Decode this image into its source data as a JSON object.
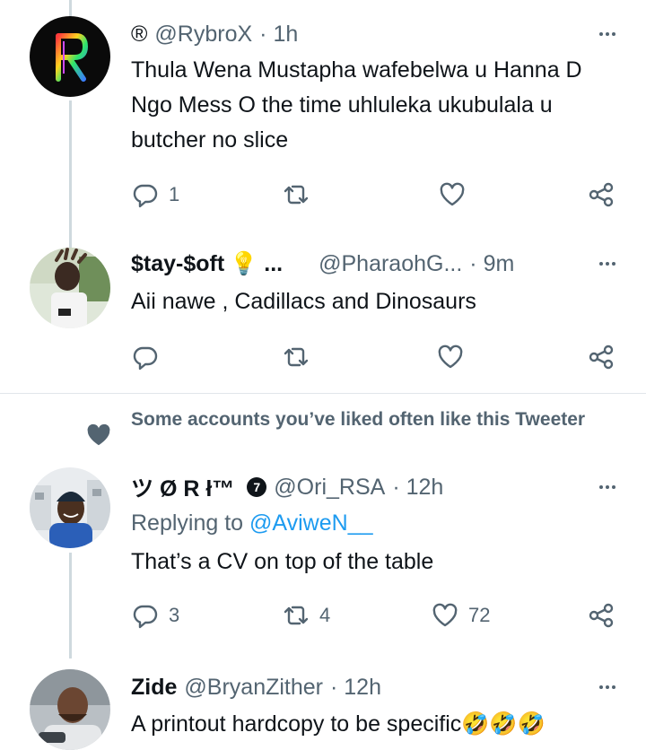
{
  "tweets": [
    {
      "display_name": "®",
      "handle": "@RybroX",
      "time": "· 1h",
      "text": "Thula Wena Mustapha wafebelwa u Hanna D Ngo Mess O the time uhluleka ukubulala u butcher no slice",
      "replies": "1",
      "retweets": "",
      "likes": ""
    },
    {
      "display_name": "$tay-$oft",
      "name_suffix": "💡 ...",
      "handle": "@PharaohG...",
      "time": "· 9m",
      "text": "Aii nawe , Cadillacs and Dinosaurs",
      "replies": "",
      "retweets": "",
      "likes": ""
    },
    {
      "display_name": "ツ Ø R ł™",
      "badge": "7",
      "handle": "@Ori_RSA",
      "time": "· 12h",
      "replying_label": "Replying to",
      "replying_handle": "@AviweN__",
      "text": "That’s a CV on top of the table",
      "replies": "3",
      "retweets": "4",
      "likes": "72"
    },
    {
      "display_name": "Zide",
      "handle": "@BryanZither",
      "time": "· 12h",
      "text": "A printout hardcopy to be specific🤣🤣🤣"
    }
  ],
  "liked_note": "Some accounts you’ve liked often like this Tweeter",
  "colors": {
    "text": "#0f1419",
    "muted": "#536471",
    "link": "#1d9bf0",
    "line": "#cfd9de"
  },
  "icons": [
    "reply-icon",
    "retweet-icon",
    "like-icon",
    "share-icon",
    "more-icon",
    "heart-icon"
  ]
}
